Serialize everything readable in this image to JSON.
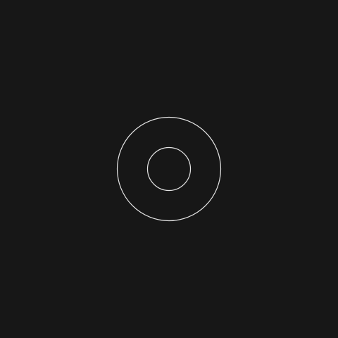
{
  "screen": {
    "background_color": "#171717",
    "stroke_color": "#e6e6e6"
  },
  "graphic": {
    "type": "concentric-circles",
    "rings": [
      {
        "name": "outer-ring-icon"
      },
      {
        "name": "inner-ring-icon"
      }
    ]
  }
}
